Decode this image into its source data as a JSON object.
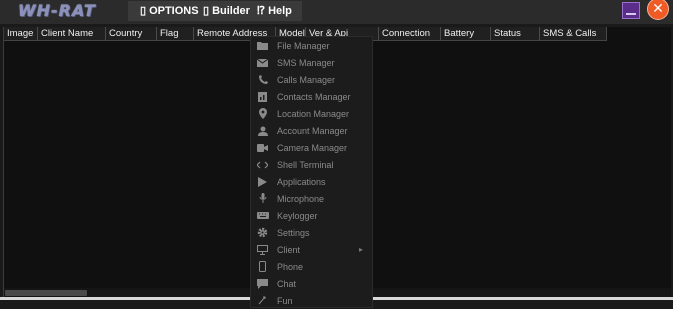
{
  "app": {
    "logo_text": "WH-RAT",
    "menus": [
      {
        "glyph": "▯",
        "label": "OPTIONS"
      },
      {
        "glyph": "▯",
        "label": "Builder"
      },
      {
        "glyph": "⁉",
        "label": "Help"
      }
    ],
    "close_glyph": "✕"
  },
  "table": {
    "columns": [
      "Image",
      "Client Name",
      "Country",
      "Flag",
      "Remote Address",
      "Model",
      "Ver & Api",
      "Connection",
      "Battery",
      "Status",
      "SMS & Calls"
    ]
  },
  "context_menu": {
    "items": [
      {
        "icon": "folder-icon",
        "label": "File Manager"
      },
      {
        "icon": "envelope-icon",
        "label": "SMS Manager"
      },
      {
        "icon": "phone-icon",
        "label": "Calls Manager"
      },
      {
        "icon": "contacts-icon",
        "label": "Contacts Manager"
      },
      {
        "icon": "location-pin-icon",
        "label": "Location Manager"
      },
      {
        "icon": "user-icon",
        "label": "Account Manager"
      },
      {
        "icon": "camera-icon",
        "label": "Camera Manager"
      },
      {
        "icon": "code-icon",
        "label": "Shell Terminal"
      },
      {
        "icon": "play-icon",
        "label": "Applications"
      },
      {
        "icon": "microphone-icon",
        "label": "Microphone"
      },
      {
        "icon": "keyboard-icon",
        "label": "Keylogger"
      },
      {
        "icon": "gear-icon",
        "label": "Settings"
      },
      {
        "icon": "monitor-icon",
        "label": "Client",
        "submenu_arrow": "▸"
      },
      {
        "icon": "smartphone-icon",
        "label": "Phone"
      },
      {
        "icon": "chat-icon",
        "label": "Chat"
      },
      {
        "icon": "fun-icon",
        "label": "Fun"
      }
    ]
  },
  "colors": {
    "background": "#1a1a1a",
    "titlebar": "#2b2b2b",
    "close_button": "#f05a24",
    "minimize_button": "#5b2d8a",
    "menu_text_disabled": "#8a8a8a"
  }
}
